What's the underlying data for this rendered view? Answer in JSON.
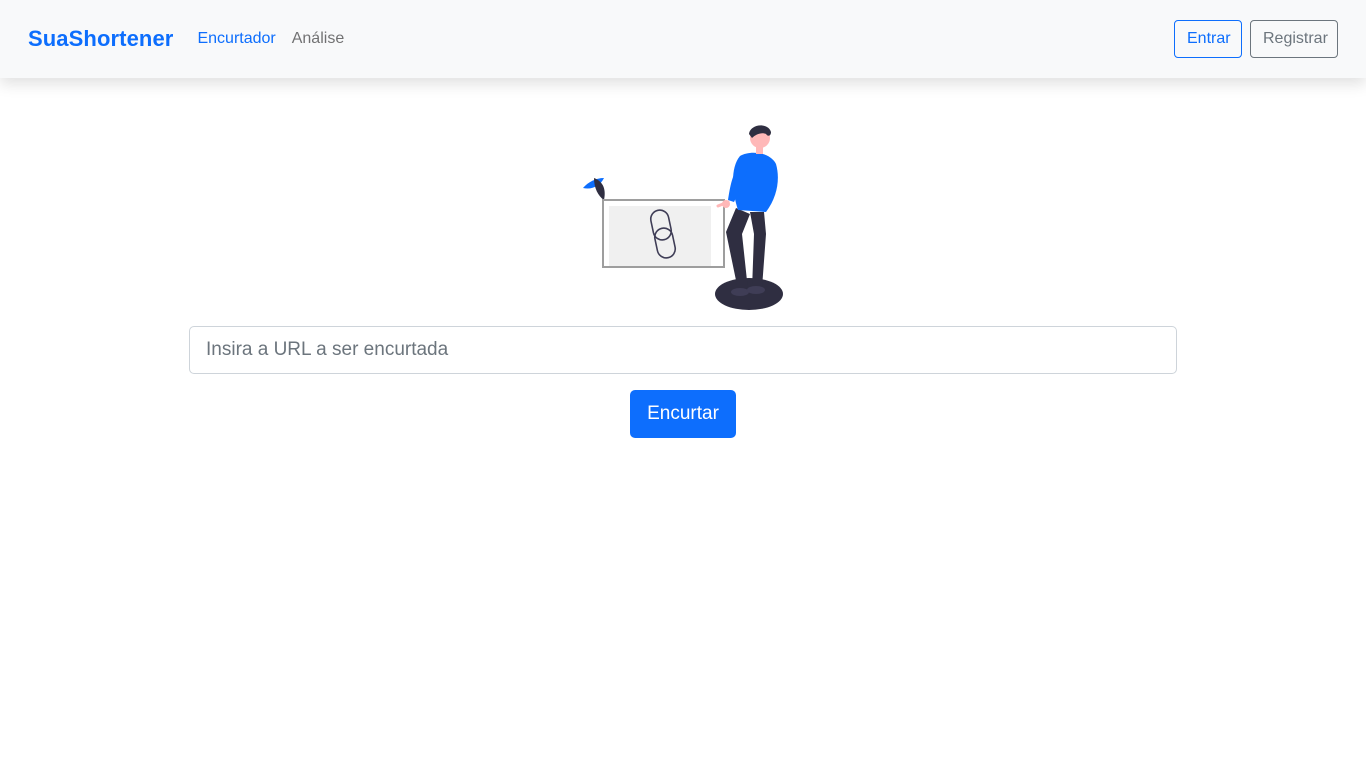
{
  "navbar": {
    "brand": "SuaShortener",
    "links": [
      {
        "label": "Encurtador",
        "active": true
      },
      {
        "label": "Análise",
        "active": false
      }
    ],
    "login_label": "Entrar",
    "register_label": "Registrar"
  },
  "main": {
    "illustration_icon": "person-with-link-illustration",
    "url_input": {
      "value": "",
      "placeholder": "Insira a URL a ser encurtada"
    },
    "shorten_button_label": "Encurtar"
  },
  "colors": {
    "primary": "#0d6efd",
    "secondary": "#6c757d",
    "navbar_bg": "#f8f9fa"
  }
}
